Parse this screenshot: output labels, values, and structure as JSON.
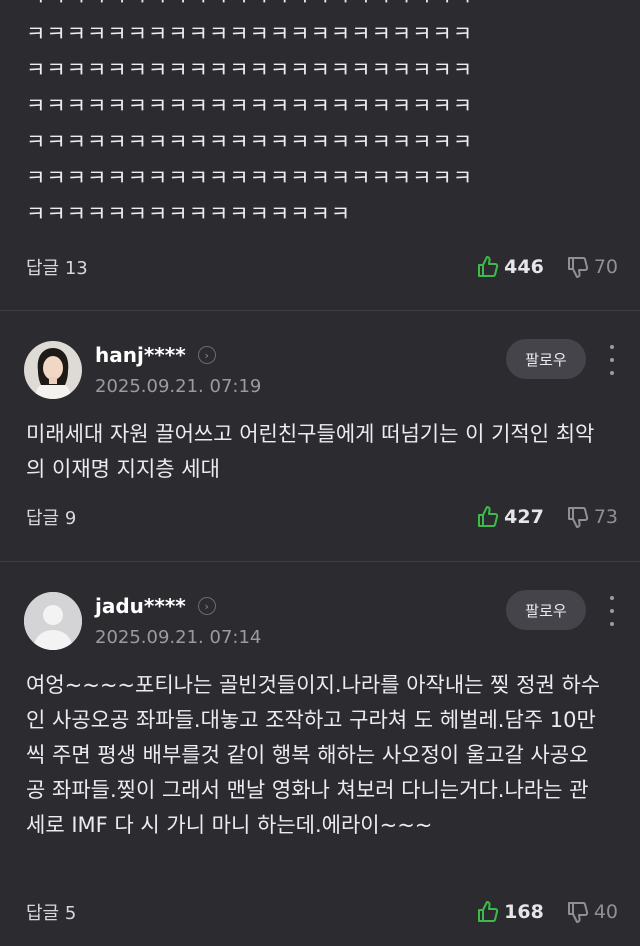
{
  "comments": [
    {
      "text": "ㅋㅋㅋㅋㅋㅋㅋㅋㅋㅋㅋㅋㅋㅋㅋㅋㅋㅋㅋㅋㅋㅋ\nㅋㅋㅋㅋㅋㅋㅋㅋㅋㅋㅋㅋㅋㅋㅋㅋㅋㅋㅋㅋㅋㅋ\nㅋㅋㅋㅋㅋㅋㅋㅋㅋㅋㅋㅋㅋㅋㅋㅋㅋㅋㅋㅋㅋㅋ\nㅋㅋㅋㅋㅋㅋㅋㅋㅋㅋㅋㅋㅋㅋㅋㅋㅋㅋㅋㅋㅋㅋ\nㅋㅋㅋㅋㅋㅋㅋㅋㅋㅋㅋㅋㅋㅋㅋㅋㅋㅋㅋㅋㅋㅋ\nㅋㅋㅋㅋㅋㅋㅋㅋㅋㅋㅋㅋㅋㅋㅋㅋㅋㅋㅋㅋㅋㅋ\nㅋㅋㅋㅋㅋㅋㅋㅋㅋㅋㅋㅋㅋㅋㅋㅋ",
      "reply_label": "답글 13",
      "likes": "446",
      "dislikes": "70"
    },
    {
      "username": "hanj****",
      "date": "2025.09.21. 07:19",
      "follow_label": "팔로우",
      "text": "미래세대 자원 끌어쓰고 어린친구들에게 떠넘기는 이 기적인 최악의 이재명 지지층 세대",
      "reply_label": "답글 9",
      "likes": "427",
      "dislikes": "73"
    },
    {
      "username": "jadu****",
      "date": "2025.09.21. 07:14",
      "follow_label": "팔로우",
      "text": "여엉~~~~포티나는 골빈것들이지.나라를 아작내는 찢 정권 하수인 사공오공 좌파들.대놓고 조작하고 구라쳐 도 헤벌레.담주 10만씩 주면 평생 배부를것 같이 행복 해하는 사오정이 울고갈 사공오공 좌파들.찢이 그래서 맨날 영화나 쳐보러 다니는거다.나라는 관세로 IMF 다 시 가니 마니 하는데.에라이~~~",
      "reply_label": "답글 5",
      "likes": "168",
      "dislikes": "40"
    }
  ],
  "colors": {
    "background": "#2c2c30",
    "like_icon": "#3dbb4a",
    "follow_button": "#44444a"
  },
  "icons": {
    "like": "thumbs-up-icon",
    "dislike": "thumbs-down-icon",
    "more": "more-vertical-icon",
    "chevron": "chevron-right-icon"
  }
}
